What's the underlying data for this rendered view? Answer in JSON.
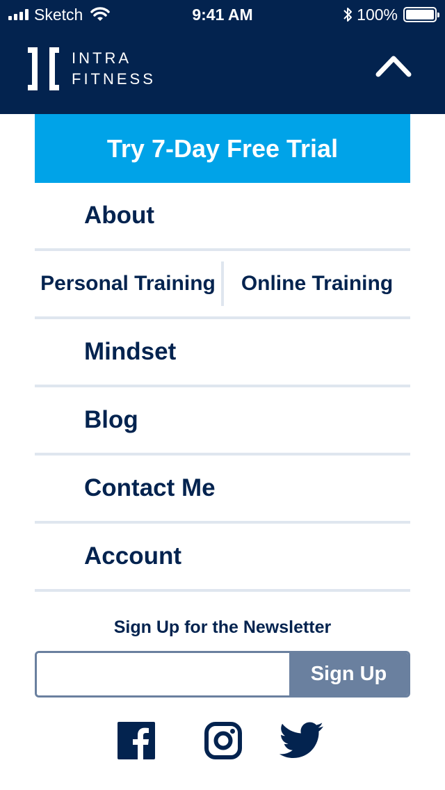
{
  "status_bar": {
    "carrier": "Sketch",
    "time": "9:41 AM",
    "battery": "100%"
  },
  "header": {
    "logo_line1": "INTRA",
    "logo_line2": "FITNESS",
    "toggle_icon": "chevron-up-icon"
  },
  "trial_banner": {
    "label": "Try 7-Day Free Trial"
  },
  "menu": {
    "about": "About",
    "personal_training": "Personal Training",
    "online_training": "Online Training",
    "mindset": "Mindset",
    "blog": "Blog",
    "contact": "Contact Me",
    "account": "Account"
  },
  "newsletter": {
    "title": "Sign Up for the Newsletter",
    "input_value": "",
    "button_label": "Sign Up"
  },
  "social": {
    "icons": [
      "facebook-icon",
      "instagram-icon",
      "twitter-icon"
    ]
  },
  "colors": {
    "navy": "#03234f",
    "accent": "#00a3e8",
    "divider": "#dfe6ef",
    "button": "#6a809f"
  }
}
